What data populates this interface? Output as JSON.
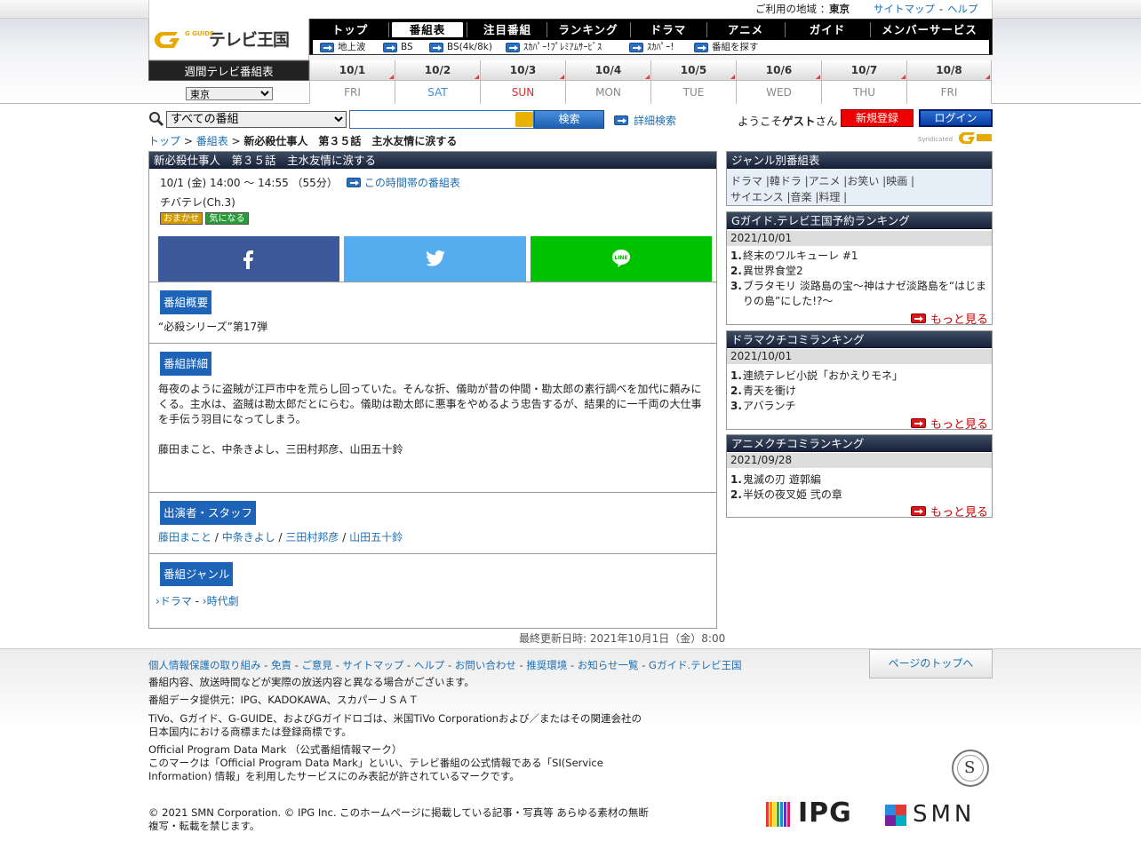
{
  "topbar": {
    "region_label": "ご利用の地域 ：",
    "region": "東京",
    "sitemap": "サイトマップ",
    "sep": "-",
    "help": "ヘルプ"
  },
  "logo": {
    "mark": "G GUIDE",
    "text": "テレビ王国"
  },
  "nav": {
    "items": [
      "トップ",
      "番組表",
      "注目番組",
      "ランキング",
      "ドラマ",
      "アニメ",
      "ガイド",
      "メンバーサービス"
    ],
    "active": 1,
    "sub": [
      "地上波",
      "BS",
      "BS(4k/8k)",
      "ｽｶﾊﾟｰ!ﾌﾟﾚﾐｱﾑｻｰﾋﾞｽ",
      "ｽｶﾊﾟｰ!",
      "番組を探す"
    ]
  },
  "week": {
    "title": "週間テレビ番組表",
    "region_select": "東京",
    "days": [
      {
        "date": "10/1",
        "dow": "FRI",
        "color": "#888888"
      },
      {
        "date": "10/2",
        "dow": "SAT",
        "color": "#3b8ed8"
      },
      {
        "date": "10/3",
        "dow": "SUN",
        "color": "#d32f2f"
      },
      {
        "date": "10/4",
        "dow": "MON",
        "color": "#888888"
      },
      {
        "date": "10/5",
        "dow": "TUE",
        "color": "#888888"
      },
      {
        "date": "10/6",
        "dow": "WED",
        "color": "#888888"
      },
      {
        "date": "10/7",
        "dow": "THU",
        "color": "#888888"
      },
      {
        "date": "10/8",
        "dow": "FRI",
        "color": "#888888"
      }
    ]
  },
  "search": {
    "select": "すべての番組",
    "button": "検索",
    "advanced": "詳細検索"
  },
  "user": {
    "welcome_pre": "ようこそ",
    "guest": "ゲスト",
    "welcome_post": "さん",
    "register": "新規登録",
    "login": "ログイン"
  },
  "breadcrumb": {
    "top": "トップ",
    "sep1": " > ",
    "schedule": "番組表",
    "sep2": " > ",
    "current": "新必殺仕事人　第３５話　主水友情に涙する"
  },
  "syndicated": "Syndicated",
  "program": {
    "title": "新必殺仕事人　第３５話　主水友情に涙する",
    "time": "10/1 (金) 14:00 ～ 14:55 （55分）",
    "timeslot_link": "この時間帯の番組表",
    "channel": "チバテレ(Ch.3)",
    "badge1": "おまかせ",
    "badge2": "気になる",
    "overview_title": "番組概要",
    "overview": "“必殺シリーズ”第17弾",
    "detail_title": "番組詳細",
    "detail": "毎夜のように盗賊が江戸市中を荒らし回っていた。そんな折、儀助が昔の仲間・勘太郎の素行調べを加代に頼みにくる。主水は、盗賊は勘太郎だとにらむ。儀助は勘太郎に悪事をやめるよう忠告するが、結果的に一千両の大仕事を手伝う羽目になってしまう。",
    "detail_cast": "藤田まこと、中条きよし、三田村邦彦、山田五十鈴",
    "cast_title": "出演者・スタッフ",
    "cast": [
      "藤田まこと",
      "中条きよし",
      "三田村邦彦",
      "山田五十鈴"
    ],
    "cast_sep": " / ",
    "genre_title": "番組ジャンル",
    "genre1": "ドラマ",
    "genre_sep": " - ",
    "genre2": "時代劇"
  },
  "last_updated": "最終更新日時: 2021年10月1日（金）8:00",
  "sidebar": {
    "genre": {
      "title": "ジャンル別番組表",
      "row1": "ドラマ |韓ドラ |アニメ |お笑い |映画 |",
      "row2": "サイエンス |音楽 |料理 |"
    },
    "ranking1": {
      "title": "Gガイド.テレビ王国予約ランキング",
      "date": "2021/10/01",
      "items": [
        "終末のワルキューレ #1",
        "異世界食堂2",
        "ブラタモリ 淡路島の宝〜神はナゼ淡路島を“はじまりの島”にした!?〜"
      ],
      "more": "もっと見る"
    },
    "ranking2": {
      "title": "ドラマクチコミランキング",
      "date": "2021/10/01",
      "items": [
        "連続テレビ小説「おかえりモネ」",
        "青天を衝け",
        "アバランチ"
      ],
      "more": "もっと見る"
    },
    "ranking3": {
      "title": "アニメクチコミランキング",
      "date": "2021/09/28",
      "items": [
        "鬼滅の刃 遊郭編",
        "半妖の夜叉姫 弐の章"
      ],
      "more": "もっと見る"
    }
  },
  "footer": {
    "links": [
      "個人情報保護の取り組み",
      "免責",
      "ご意見",
      "サイトマップ",
      "ヘルプ",
      "お問い合わせ",
      "推奨環境",
      "お知らせ一覧",
      "Gガイド.テレビ王国"
    ],
    "pagetop": "ページのトップへ",
    "note1": "番組内容、放送時間などが実際の放送内容と異なる場合がございます。",
    "note2": "番組データ提供元：IPG、KADOKAWA、スカパーＪＳＡＴ",
    "note3a": "TiVo、Gガイド、G-GUIDE、およびGガイドロゴは、米国TiVo Corporationおよび／またはその関連会社の",
    "note3b": "日本国内における商標または登録商標です。",
    "note4a": "Official Program Data Mark （公式番組情報マーク）",
    "note4b": "このマークは「Official Program Data Mark」といい、テレビ番組の公式情報である「SI(Service",
    "note4c": "Information) 情報」を利用したサービスにのみ表記が許されているマークです。",
    "copy1": "© 2021 SMN Corporation. © IPG Inc. このホームページに掲載している記事・写真等 あらゆる素材の無断",
    "copy2": "複写・転載を禁じます。",
    "ipg": "IPG",
    "smn": "SMN",
    "seal": "S"
  }
}
